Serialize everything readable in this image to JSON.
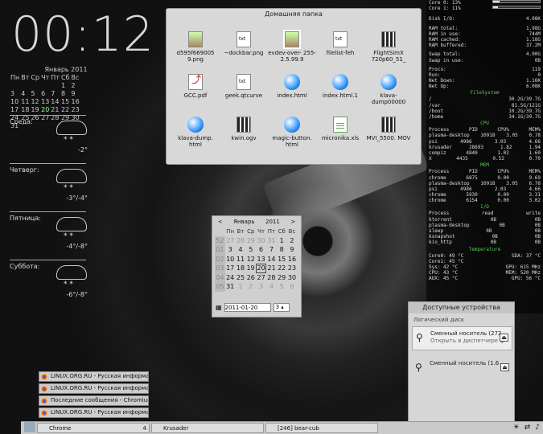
{
  "clock": "00:12",
  "small_calendar": {
    "title": "Январь 2011",
    "weekdays": [
      "Пн",
      "Вт",
      "Ср",
      "Чт",
      "Пт",
      "Сб",
      "Вс"
    ],
    "rows": [
      [
        "",
        "",
        "",
        "",
        "",
        "1",
        "2"
      ],
      [
        "3",
        "4",
        "5",
        "6",
        "7",
        "8",
        "9"
      ],
      [
        "10",
        "11",
        "12",
        "13",
        "14",
        "15",
        "16"
      ],
      [
        "17",
        "18",
        "19",
        "20",
        "21",
        "22",
        "23"
      ],
      [
        "24",
        "25",
        "26",
        "27",
        "28",
        "29",
        "30"
      ],
      [
        "31",
        "",
        "",
        "",
        "",
        "",
        ""
      ]
    ]
  },
  "weather": [
    {
      "day": "Среда:",
      "temp": "-2°"
    },
    {
      "day": "Четверг:",
      "temp": "-3°/-4°"
    },
    {
      "day": "Пятница:",
      "temp": "-4°/-8°"
    },
    {
      "day": "Суббота:",
      "temp": "-6°/-8°"
    }
  ],
  "file_window": {
    "title": "Домашняя папка",
    "files": [
      "d595f669005 9.png",
      "~dockbar.png",
      "evdev-over- 255-2.5.99.9",
      "filelist-feh",
      "FlightSimX 720p60_51_",
      "GCC.pdf",
      "geek.qtcurve",
      "index.html",
      "index.html.1",
      "klava- dump00000",
      "klava-dump. html",
      "kwin.ogv",
      "magic-button. html",
      "micronika.xls",
      "MVI_5500. MOV"
    ]
  },
  "monitor": {
    "cpu": [
      {
        "l": "Core 0: 13%",
        "v": 0.13
      },
      {
        "l": "Core 1: 11%",
        "v": 0.11
      }
    ],
    "disk": [
      [
        "Disk I/O:",
        "4.08K"
      ]
    ],
    "ram": [
      [
        "RAM total:",
        "1.98G"
      ],
      [
        "RAM in use:",
        "744M"
      ],
      [
        "RAM cached:",
        "1.18G"
      ],
      [
        "RAM buffered:",
        "37.2M"
      ]
    ],
    "swap": [
      [
        "Swap total:",
        "4.00G"
      ],
      [
        "Swap in use:",
        "0B"
      ]
    ],
    "procs": [
      [
        "Procs:",
        "119"
      ],
      [
        "Run:",
        "0"
      ],
      [
        "Net Down:",
        "1.16K"
      ],
      [
        "Net Up:",
        "6.08K"
      ]
    ],
    "fs_title": "FileSystem",
    "fs": [
      [
        "/",
        "30.2G/39.7G"
      ],
      [
        "/var",
        "81.5G/121G"
      ],
      [
        "/boot",
        "10.2G/39.7G"
      ],
      [
        "/home",
        "34.1G/39.7G"
      ]
    ],
    "cpu_title": "CPU",
    "cpu_head": [
      "Process",
      "PID",
      "CPU%",
      "MEM%"
    ],
    "cpu_rows": [
      [
        "plasma-desktop",
        "10918",
        "3.05",
        "0.78"
      ],
      [
        "psi",
        "4986",
        "3.03",
        "4.66"
      ],
      [
        "krusader",
        "28693",
        "1.82",
        "1.94"
      ],
      [
        "compiz",
        "4840",
        "1.02",
        "1.60"
      ],
      [
        "X",
        "4435",
        "0.52",
        "0.70"
      ]
    ],
    "mem_title": "MEM",
    "mem_head": [
      "Process",
      "PID",
      "CPU%",
      "MEM%"
    ],
    "mem_rows": [
      [
        "chrome",
        "6875",
        "0.00",
        "9.69"
      ],
      [
        "plasma-desktop",
        "10918",
        "3.05",
        "6.78"
      ],
      [
        "psi",
        "4986",
        "2.03",
        "4.66"
      ],
      [
        "chrome",
        "5930",
        "0.00",
        "3.31"
      ],
      [
        "chrome",
        "6154",
        "0.00",
        "3.02"
      ]
    ],
    "io_title": "I/O",
    "io_head": [
      "Process",
      "read",
      "write"
    ],
    "io_rows": [
      [
        "ktorrent",
        "0B",
        "0B"
      ],
      [
        "plasma-desktop",
        "0B",
        "0B"
      ],
      [
        "sleep",
        "0B",
        "0B"
      ],
      [
        "ksnapshot",
        "0B",
        "0B"
      ],
      [
        "kio_http",
        "0B",
        "0B"
      ]
    ],
    "temp_title": "Temperature",
    "temps": [
      [
        "Core0: 49 °C",
        "SDA: 37 °C"
      ],
      [
        "Core1: 45 °C",
        ""
      ],
      [
        "Sys: 42 °C",
        "GPU: 615 MHz"
      ],
      [
        "CPU: 43 °C",
        "MEM: 520 MHz"
      ],
      [
        "AUX: 45 °C",
        "GPU: 56 °C"
      ]
    ]
  },
  "big_calendar": {
    "month": "Январь",
    "year": "2011",
    "weekdays": [
      "Пн",
      "Вт",
      "Ср",
      "Чт",
      "Пт",
      "Сб",
      "Вс"
    ],
    "weeks": [
      {
        "w": "52",
        "d": [
          "27",
          "28",
          "29",
          "30",
          "31",
          "1",
          "2"
        ],
        "dim": [
          1,
          1,
          1,
          1,
          1,
          0,
          0
        ]
      },
      {
        "w": "01",
        "d": [
          "3",
          "4",
          "5",
          "6",
          "7",
          "8",
          "9"
        ],
        "dim": [
          0,
          0,
          0,
          0,
          0,
          0,
          0
        ]
      },
      {
        "w": "02",
        "d": [
          "10",
          "11",
          "12",
          "13",
          "14",
          "15",
          "16"
        ],
        "dim": [
          0,
          0,
          0,
          0,
          0,
          0,
          0
        ]
      },
      {
        "w": "03",
        "d": [
          "17",
          "18",
          "19",
          "20",
          "21",
          "22",
          "23"
        ],
        "dim": [
          0,
          0,
          0,
          0,
          0,
          0,
          0
        ]
      },
      {
        "w": "04",
        "d": [
          "24",
          "25",
          "26",
          "27",
          "28",
          "29",
          "30"
        ],
        "dim": [
          0,
          0,
          0,
          0,
          0,
          0,
          0
        ]
      },
      {
        "w": "05",
        "d": [
          "31",
          "1",
          "2",
          "3",
          "4",
          "5",
          "6"
        ],
        "dim": [
          0,
          1,
          1,
          1,
          1,
          1,
          1
        ]
      }
    ],
    "date_value": "2011-01-20",
    "week_value": "3"
  },
  "devices": {
    "title": "Доступные устройства",
    "subtitle": "Логический диск",
    "items": [
      {
        "name": "Сменный носитель (272",
        "desc": "Открыть в диспетчере ф"
      },
      {
        "name": "Сменный носитель (1.6",
        "desc": ""
      }
    ]
  },
  "chrome_tasks": [
    "LINUX.ORG.RU - Русская информа",
    "LINUX.ORG.RU - Русская информа",
    "Последние сообщения - Chromium",
    "LINUX.ORG.RU - Русская информа"
  ],
  "taskbar": {
    "tasks": [
      "Chrome",
      "Krusader",
      "[246] bear-cub"
    ],
    "counts": [
      "4",
      "",
      ""
    ]
  }
}
